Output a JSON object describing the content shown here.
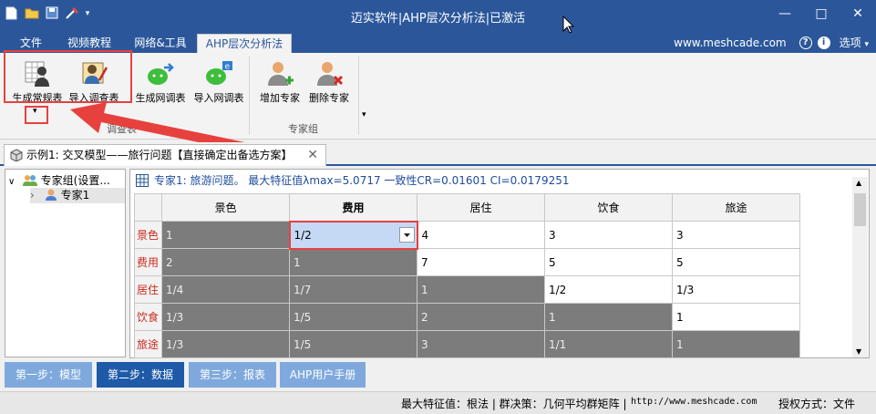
{
  "window": {
    "title": "迈实软件|AHP层次分析法|已激活",
    "controls": [
      "—",
      "□",
      "✕"
    ]
  },
  "ribbon_tabs": [
    {
      "label": "文件"
    },
    {
      "label": "视频教程"
    },
    {
      "label": "网络&工具"
    },
    {
      "label": "AHP层次分析法",
      "active": true
    }
  ],
  "header_right": {
    "website": "www.meshcade.com",
    "help_symbol": "?",
    "info_symbol": "i",
    "options": "选项",
    "options_caret": "▾"
  },
  "ribbon": {
    "buttons": [
      {
        "label": "生成常规表",
        "icon": "table-person-icon"
      },
      {
        "label": "导入调查表",
        "icon": "person-writing-icon"
      },
      {
        "label": "生成网调表",
        "icon": "wechat-export-icon"
      },
      {
        "label": "导入网调表",
        "icon": "wechat-import-icon"
      },
      {
        "label": "增加专家",
        "icon": "add-user-icon"
      },
      {
        "label": "删除专家",
        "icon": "remove-user-icon"
      }
    ],
    "groups": [
      {
        "label": "调查表"
      },
      {
        "label": "专家组"
      }
    ],
    "dropdown_caret": "▾"
  },
  "document_tab": {
    "title": "示例1: 交叉模型——旅行问题【直接确定出备选方案】",
    "close": "✕"
  },
  "tree": {
    "root": {
      "expander": "∨",
      "label": "专家组(设置..."
    },
    "child": {
      "expander": "›",
      "label": "专家1"
    }
  },
  "grid": {
    "header": "专家1: 旅游问题。 最大特征值λmax=5.0717 一致性CR=0.01601 CI=0.0179251",
    "columns": [
      "景色",
      "费用",
      "居住",
      "饮食",
      "旅途"
    ],
    "rows": [
      {
        "label": "景色",
        "cells": [
          "1",
          "1/2",
          "4",
          "3",
          "3"
        ]
      },
      {
        "label": "费用",
        "cells": [
          "2",
          "1",
          "7",
          "5",
          "5"
        ]
      },
      {
        "label": "居住",
        "cells": [
          "1/4",
          "1/7",
          "1",
          "1/2",
          "1/3"
        ]
      },
      {
        "label": "饮食",
        "cells": [
          "1/3",
          "1/5",
          "2",
          "1",
          "1"
        ]
      },
      {
        "label": "旅途",
        "cells": [
          "1/3",
          "1/5",
          "3",
          "1/1",
          "1"
        ]
      }
    ]
  },
  "bottom_buttons": [
    {
      "label": "第一步：模型"
    },
    {
      "label": "第二步：数据",
      "active": true
    },
    {
      "label": "第三步：报表"
    },
    {
      "label": "AHP用户手册"
    }
  ],
  "statusbar": {
    "eigen": "最大特征值：根法 | 群决策：几何平均群矩阵 |",
    "url": "http://www.meshcade.com",
    "license": "授权方式：文件"
  },
  "colors": {
    "brand_blue": "#2b579a",
    "highlight_red": "#e7413e",
    "gray_cell": "#7c7c7c"
  }
}
